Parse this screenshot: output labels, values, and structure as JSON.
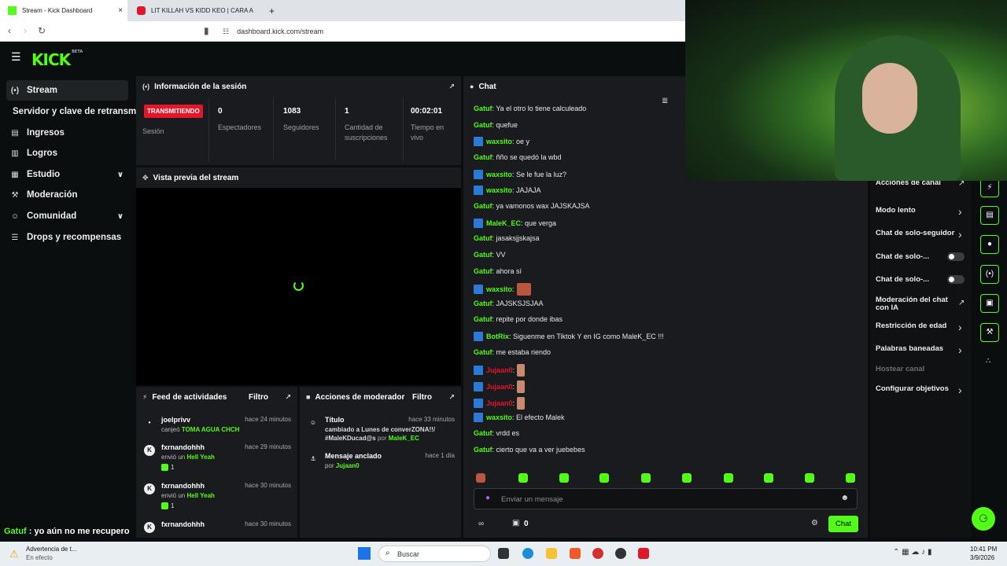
{
  "browser": {
    "tabs": [
      {
        "title": "Stream - Kick Dashboard",
        "close": "×"
      },
      {
        "title": "LIT KILLAH VS KIDD KEO | CARA A CA"
      }
    ],
    "new_tab": "+",
    "url": "dashboard.kick.com/stream"
  },
  "kick": {
    "logo": "KICK",
    "logo_badge": "BETA"
  },
  "sidebar": {
    "items": [
      {
        "label": "Stream",
        "icon": "broadcast-icon"
      },
      {
        "label": "Servidor y clave de retransm"
      },
      {
        "label": "Ingresos",
        "icon": "chart-icon"
      },
      {
        "label": "Logros",
        "icon": "book-icon"
      },
      {
        "label": "Estudio",
        "icon": "grid-icon"
      },
      {
        "label": "Moderación",
        "icon": "wrench-icon"
      },
      {
        "label": "Comunidad",
        "icon": "users-icon"
      },
      {
        "label": "Drops y recompensas",
        "icon": "drops-icon"
      }
    ]
  },
  "session": {
    "title": "Información de la sesión",
    "live_badge": "TRANSMITIENDO",
    "session_label": "Sesión",
    "stats": [
      {
        "value": "0",
        "label": "Espectadores"
      },
      {
        "value": "1083",
        "label": "Seguidores"
      },
      {
        "value": "1",
        "label": "Cantidad de suscripciones"
      },
      {
        "value": "00:02:01",
        "label": "Tiempo en vivo"
      }
    ]
  },
  "preview": {
    "title": "Vista previa del stream"
  },
  "feed": {
    "title": "Feed de actividades",
    "filter": "Filtro",
    "rows": [
      {
        "name": "joelprivv",
        "time": "hace 24 minutos",
        "action": "canjeó",
        "item": "TOMA AGUA CHCH"
      },
      {
        "name": "fxrnandohhh",
        "time": "hace 29 minutos",
        "action": "envió un",
        "item": "Hell Yeah",
        "count": "1"
      },
      {
        "name": "fxrnandohhh",
        "time": "hace 30 minutos",
        "action": "envió un",
        "item": "Hell Yeah",
        "count": "1"
      },
      {
        "name": "fxrnandohhh",
        "time": "hace 30 minutos"
      }
    ]
  },
  "mod_actions": {
    "title": "Acciones de moderador",
    "filter": "Filtro",
    "rows": [
      {
        "name": "Título",
        "time": "hace 33 minutos",
        "line1": "cambiado a Lunes de converZONA!!/",
        "line2": "#MaleKDucad@s",
        "by": "por",
        "user": "MaleK_EC"
      },
      {
        "name": "Mensaje anclado",
        "time": "hace 1 día",
        "by": "por",
        "user": "Jujaan0"
      }
    ]
  },
  "chat": {
    "title": "Chat",
    "messages": [
      {
        "user": "Gatuf",
        "color": "g",
        "text": ": Ya el otro lo tiene calculeado"
      },
      {
        "user": "Gatuf",
        "color": "g",
        "text": ": quefue"
      },
      {
        "user": "waxsito",
        "color": "g",
        "badge": true,
        "text": ": oe y"
      },
      {
        "user": "Gatuf",
        "color": "g",
        "text": ": ñño se quedó la wbd"
      },
      {
        "user": "waxsito",
        "color": "g",
        "badge": true,
        "text": ": Se le fue la luz?"
      },
      {
        "user": "waxsito",
        "color": "g",
        "badge": true,
        "text": ": JAJAJA"
      },
      {
        "user": "Gatuf",
        "color": "g",
        "text": ": ya vamonos wax JAJSKAJSA"
      },
      {
        "user": "MaleK_EC",
        "color": "g",
        "badge": true,
        "text": ": que verga"
      },
      {
        "user": "Gatuf",
        "color": "g",
        "text": ": jasaksjjskajsa"
      },
      {
        "user": "Gatuf",
        "color": "g",
        "text": ": VV"
      },
      {
        "user": "Gatuf",
        "color": "g",
        "text": ": ahora sí"
      },
      {
        "user": "waxsito",
        "color": "g",
        "badge": true,
        "text": ":",
        "emote": true
      },
      {
        "user": "Gatuf",
        "color": "g",
        "text": ": JAJSKSJSJAA"
      },
      {
        "user": "Gatuf",
        "color": "g",
        "text": ": repite por donde ibas"
      },
      {
        "user": "BotRix",
        "color": "g",
        "badge": true,
        "text": ": Siguenme en Tiktok Y en IG como MaleK_EC !!!"
      },
      {
        "user": "Gatuf",
        "color": "g",
        "text": ": me estaba riendo"
      },
      {
        "user": "Jujaan0",
        "color": "r",
        "badge": true,
        "text": ":",
        "emote_sm": true
      },
      {
        "user": "Jujaan0",
        "color": "r",
        "badge": true,
        "text": ":",
        "emote_sm": true
      },
      {
        "user": "Jujaan0",
        "color": "r",
        "badge": true,
        "text": ":",
        "emote_sm": true
      },
      {
        "user": "waxsito",
        "color": "g",
        "badge": true,
        "text": ": El efecto Malek"
      },
      {
        "user": "Gatuf",
        "color": "g",
        "text": ": vrdd es"
      },
      {
        "user": "Gatuf",
        "color": "g",
        "text": ": cierto que va a ver juebebes"
      }
    ],
    "input_placeholder": "Enviar un mensaje",
    "viewer_count": "0",
    "send_button": "Chat"
  },
  "tools": {
    "items": [
      {
        "label": "Acciones de canal"
      },
      {
        "label": "Modo lento"
      },
      {
        "label": "Chat de solo-seguidor"
      },
      {
        "label": "Chat de solo-..."
      },
      {
        "label": "Chat de solo-..."
      },
      {
        "label": "Moderación del chat con IA"
      },
      {
        "label": "Restricción de edad"
      },
      {
        "label": "Palabras baneadas"
      },
      {
        "label": "Hostear canal"
      },
      {
        "label": "Configurar objetivos"
      }
    ]
  },
  "overlay": {
    "user": "Gatuf",
    "text": " : yo aún no me recupero"
  },
  "taskbar": {
    "weather_title": "Advertencia de t...",
    "weather_sub": "En efecto",
    "search": "Buscar",
    "time": "10:41 PM",
    "date": "3/9/2026"
  },
  "colors": {
    "accent": "#53fc18",
    "live": "#e4162a",
    "panel": "#191b1f",
    "background": "#0b0e0f"
  }
}
